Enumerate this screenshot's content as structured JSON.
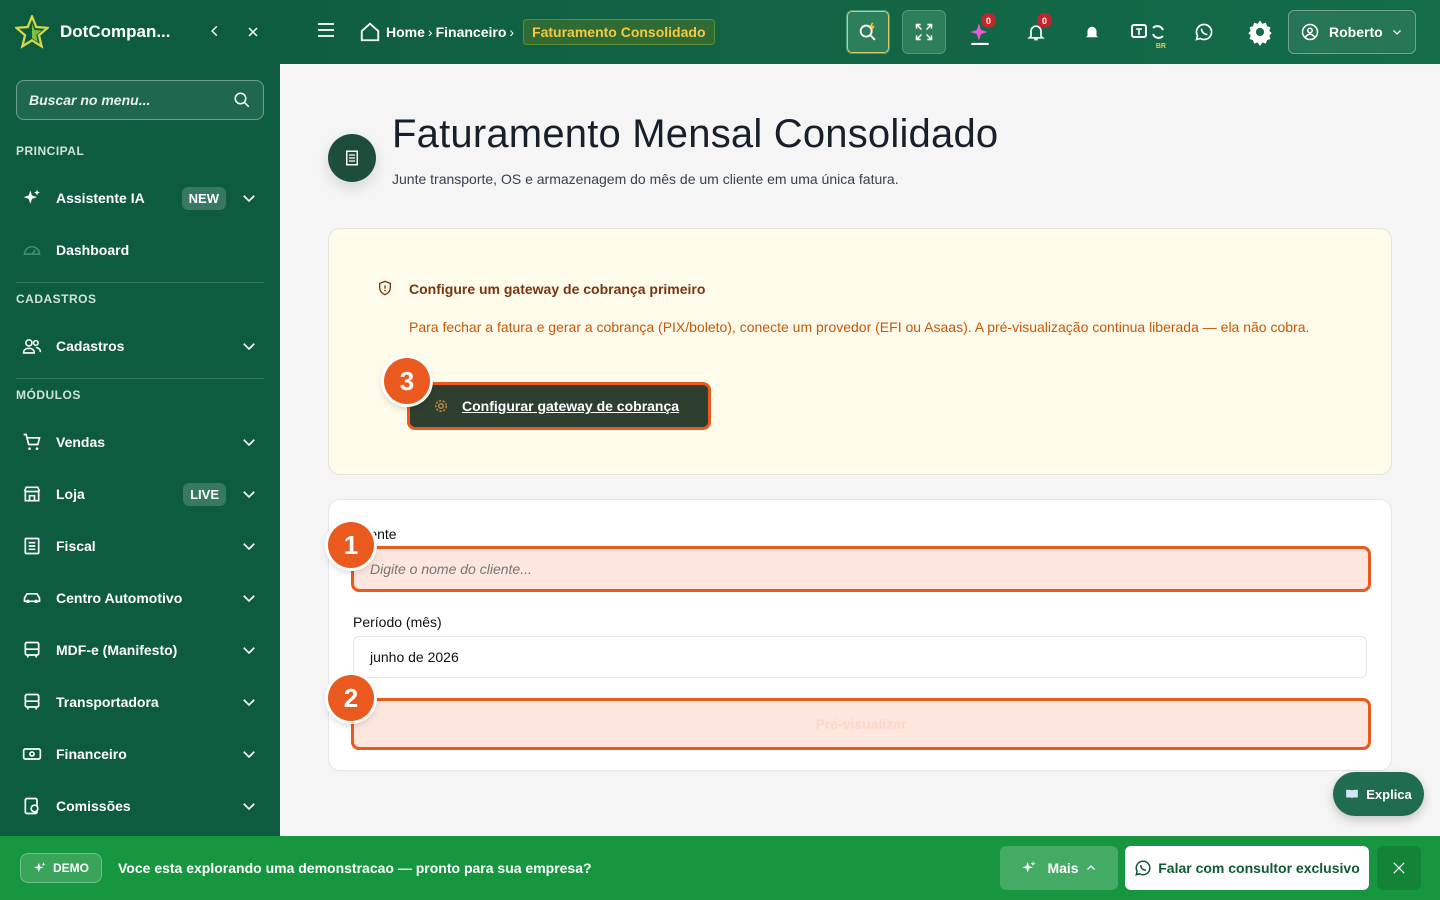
{
  "sidebar": {
    "brand": "DotCompan...",
    "search_placeholder": "Buscar no menu...",
    "sections": {
      "principal": "PRINCIPAL",
      "cadastros": "CADASTROS",
      "modulos": "MÓDULOS"
    },
    "items": {
      "assistente": {
        "label": "Assistente IA",
        "badge": "NEW"
      },
      "dashboard": {
        "label": "Dashboard"
      },
      "cadastros": {
        "label": "Cadastros"
      },
      "vendas": {
        "label": "Vendas"
      },
      "loja": {
        "label": "Loja",
        "badge": "LIVE"
      },
      "fiscal": {
        "label": "Fiscal"
      },
      "automotivo": {
        "label": "Centro Automotivo"
      },
      "mdfe": {
        "label": "MDF-e (Manifesto)"
      },
      "transportadora": {
        "label": "Transportadora"
      },
      "financeiro": {
        "label": "Financeiro"
      },
      "comissoes": {
        "label": "Comissões"
      }
    }
  },
  "topbar": {
    "breadcrumb": {
      "home": "Home",
      "financeiro": "Financeiro",
      "current": "Faturamento Consolidado"
    },
    "badges": {
      "ai": "0",
      "notifications": "0"
    },
    "lang_tag": "BR",
    "user": "Roberto"
  },
  "page": {
    "title": "Faturamento Mensal Consolidado",
    "subtitle": "Junte transporte, OS e armazenagem do mês de um cliente em uma única fatura."
  },
  "alert": {
    "title": "Configure um gateway de cobrança primeiro",
    "text": "Para fechar a fatura e gerar a cobrança (PIX/boleto), conecte um provedor (EFI ou Asaas). A pré-visualização continua liberada — ela não cobra.",
    "button": "Configurar gateway de cobrança"
  },
  "form": {
    "cliente_label": "Cliente",
    "cliente_placeholder": "Digite o nome do cliente...",
    "periodo_label": "Período (mês)",
    "periodo_value": "junho de 2026",
    "preview_button": "Pré-visualizar"
  },
  "markers": {
    "m1": "1",
    "m2": "2",
    "m3": "3"
  },
  "explica": "Explica",
  "bottombar": {
    "demo": "DEMO",
    "msg_prefix": "Voce esta explorando uma ",
    "msg_bold": "demonstracao",
    "msg_suffix": " — pronto para sua empresa?",
    "mais": "Mais",
    "consultor": "Falar com consultor exclusivo"
  },
  "colors": {
    "sidebar": "#0d5c40",
    "accent": "#ea5a1e",
    "bottom": "#16963f"
  }
}
